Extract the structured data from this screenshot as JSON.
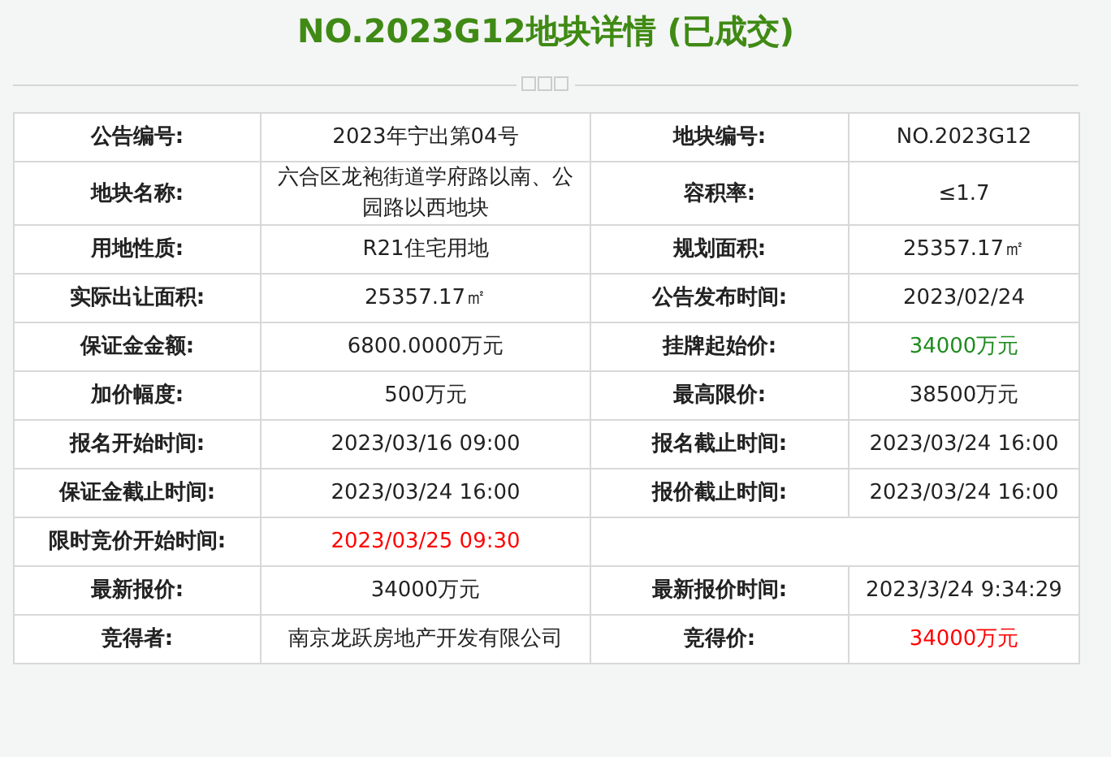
{
  "title": "NO.2023G12地块详情 (已成交)",
  "rows": [
    {
      "fields": [
        {
          "label": "公告编号:",
          "value": "2023年宁出第04号"
        },
        {
          "label": "地块编号:",
          "value": "NO.2023G12"
        }
      ]
    },
    {
      "fields": [
        {
          "label": "地块名称:",
          "value": "六合区龙袍街道学府路以南、公园路以西地块"
        },
        {
          "label": "容积率:",
          "value": "≤1.7"
        }
      ]
    },
    {
      "fields": [
        {
          "label": "用地性质:",
          "value": "R21住宅用地"
        },
        {
          "label": "规划面积:",
          "value": "25357.17㎡"
        }
      ]
    },
    {
      "fields": [
        {
          "label": "实际出让面积:",
          "value": "25357.17㎡"
        },
        {
          "label": "公告发布时间:",
          "value": "2023/02/24"
        }
      ]
    },
    {
      "fields": [
        {
          "label": "保证金金额:",
          "value": "6800.0000万元"
        },
        {
          "label": "挂牌起始价:",
          "value": "34000万元",
          "color": "#1e8c1e"
        }
      ]
    },
    {
      "fields": [
        {
          "label": "加价幅度:",
          "value": "500万元"
        },
        {
          "label": "最高限价:",
          "value": "38500万元"
        }
      ]
    },
    {
      "fields": [
        {
          "label": "报名开始时间:",
          "value": "2023/03/16 09:00"
        },
        {
          "label": "报名截止时间:",
          "value": "2023/03/24 16:00"
        }
      ]
    },
    {
      "fields": [
        {
          "label": "保证金截止时间:",
          "value": "2023/03/24 16:00"
        },
        {
          "label": "报价截止时间:",
          "value": "2023/03/24 16:00"
        }
      ]
    },
    {
      "fields": [
        {
          "label": "限时竞价开始时间:",
          "value": "2023/03/25 09:30",
          "color": "#ff0000"
        }
      ]
    },
    {
      "fields": [
        {
          "label": "最新报价:",
          "value": "34000万元"
        },
        {
          "label": "最新报价时间:",
          "value": "2023/3/24 9:34:29"
        }
      ]
    },
    {
      "fields": [
        {
          "label": "竞得者:",
          "value": "南京龙跃房地产开发有限公司"
        },
        {
          "label": "竞得价:",
          "value": "34000万元",
          "color": "#ff0000"
        }
      ]
    }
  ]
}
